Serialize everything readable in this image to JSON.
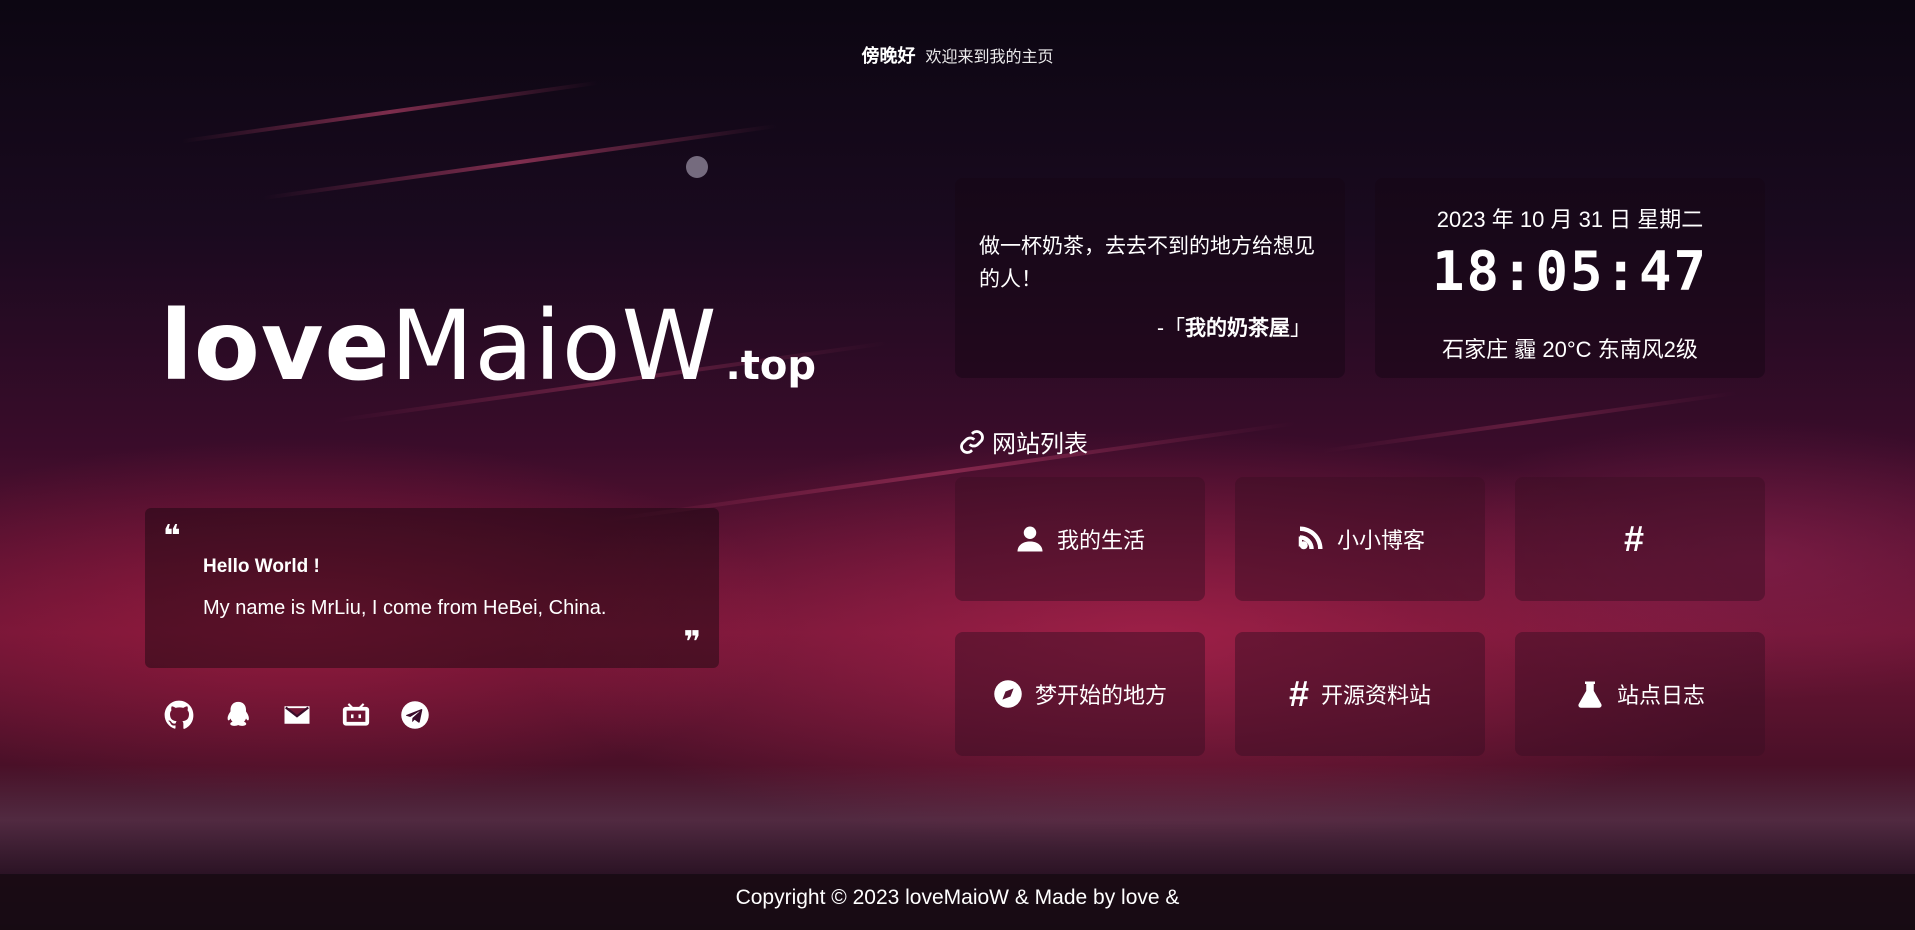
{
  "header": {
    "hello": "傍晚好",
    "welcome": "欢迎来到我的主页"
  },
  "logo": {
    "part1": "love",
    "part2": "MaioW",
    "tld": ".top"
  },
  "intro": {
    "open_quote": "❝",
    "close_quote": "❞",
    "line1": "Hello World !",
    "line2": "My name is MrLiu, I come from HeBei, China."
  },
  "social": [
    "github-icon",
    "qq-icon",
    "email-icon",
    "bilibili-icon",
    "telegram-icon"
  ],
  "quote": {
    "text": "做一杯奶茶，去去不到的地方给想见的人！",
    "from_prefix": "-「",
    "from_name": "我的奶茶屋",
    "from_suffix": "」"
  },
  "time": {
    "date": "2023 年 10 月 31 日 星期二",
    "clock": "18:05:47",
    "weather": "石家庄 霾 20°C 东南风2级"
  },
  "site_list": {
    "title": "网站列表",
    "links": [
      {
        "label": "我的生活",
        "icon": "user-icon"
      },
      {
        "label": "小小博客",
        "icon": "blog-icon"
      },
      {
        "label": "",
        "icon": "hash-icon"
      },
      {
        "label": "梦开始的地方",
        "icon": "compass-icon"
      },
      {
        "label": "开源资料站",
        "icon": "hash-icon"
      },
      {
        "label": "站点日志",
        "icon": "flask-icon"
      }
    ]
  },
  "footer": {
    "text": "Copyright © 2023 loveMaioW & Made by love &"
  }
}
